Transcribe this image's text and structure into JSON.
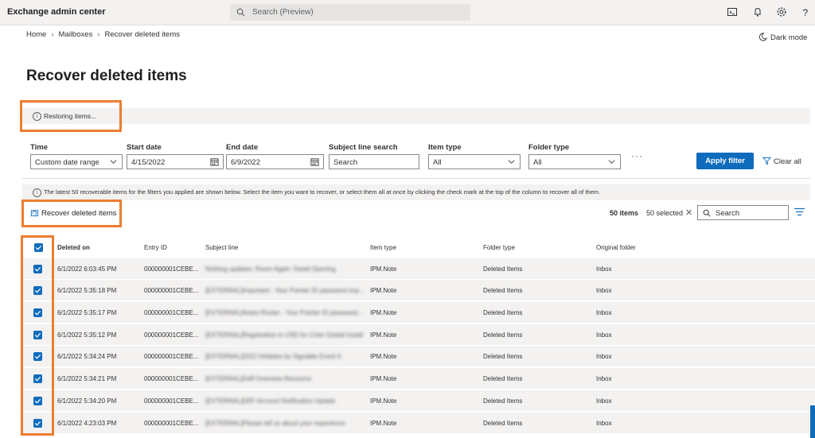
{
  "app": {
    "title": "Exchange admin center"
  },
  "search": {
    "placeholder": "Search (Preview)"
  },
  "topbar_icons": [
    "terminal-icon",
    "bell-icon",
    "gear-icon",
    "help-icon"
  ],
  "breadcrumb": [
    "Home",
    "Mailboxes",
    "Recover deleted items"
  ],
  "dark_mode": "Dark mode",
  "page_title": "Recover deleted items",
  "status": {
    "restoring": "Restoring items..."
  },
  "filters": {
    "time": {
      "label": "Time",
      "value": "Custom date range"
    },
    "start_date": {
      "label": "Start date",
      "value": "4/15/2022"
    },
    "end_date": {
      "label": "End date",
      "value": "6/9/2022"
    },
    "subject": {
      "label": "Subject line search",
      "placeholder": "Search"
    },
    "item_type": {
      "label": "Item type",
      "value": "All"
    },
    "folder_type": {
      "label": "Folder type",
      "value": "All"
    },
    "more": "···",
    "apply": "Apply filter",
    "clear": "Clear all"
  },
  "notice": "The latest 50 recoverable items for the filters you applied are shown below. Select the item you want to recover, or select them all at once by clicking the check mark at the top of the column to recover all of them.",
  "toolbar": {
    "recover": "Recover deleted items",
    "items_count": "50 items",
    "selected_count": "50 selected",
    "search_placeholder": "Search"
  },
  "table": {
    "columns": [
      "Deleted on",
      "Entry ID",
      "Subject line",
      "Item type",
      "Folder type",
      "Original folder"
    ],
    "rows": [
      {
        "deleted_on": "6/1/2022 6:03:45 PM",
        "entry_id": "000000001CEBE...",
        "subject": "Nothing updates: Room Again: Detail Opening",
        "item_type": "IPM.Note",
        "folder_type": "Deleted Items",
        "original_folder": "Inbox"
      },
      {
        "deleted_on": "6/1/2022 5:35:18 PM",
        "entry_id": "000000001CEBE...",
        "subject": "[EXTERNAL]Important - Your Pointer ID password exp...",
        "item_type": "IPM.Note",
        "folder_type": "Deleted Items",
        "original_folder": "Inbox"
      },
      {
        "deleted_on": "6/1/2022 5:35:17 PM",
        "entry_id": "000000001CEBE...",
        "subject": "[EXTERNAL]Notes Router - Your Pointer ID password...",
        "item_type": "IPM.Note",
        "folder_type": "Deleted Items",
        "original_folder": "Inbox"
      },
      {
        "deleted_on": "6/1/2022 5:35:12 PM",
        "entry_id": "000000001CEBE...",
        "subject": "[EXTERNAL]Registration in USD for Color Global Install",
        "item_type": "IPM.Note",
        "folder_type": "Deleted Items",
        "original_folder": "Inbox"
      },
      {
        "deleted_on": "6/1/2022 5:34:24 PM",
        "entry_id": "000000001CEBE...",
        "subject": "[EXTERNAL]2022 Infobites by Signable Event II",
        "item_type": "IPM.Note",
        "folder_type": "Deleted Items",
        "original_folder": "Inbox"
      },
      {
        "deleted_on": "6/1/2022 5:34:21 PM",
        "entry_id": "000000001CEBE...",
        "subject": "[EXTERNAL]Daff Overview Resource",
        "item_type": "IPM.Note",
        "folder_type": "Deleted Items",
        "original_folder": "Inbox"
      },
      {
        "deleted_on": "6/1/2022 5:34:20 PM",
        "entry_id": "000000001CEBE...",
        "subject": "[EXTERNAL]DEF Account Notification Update",
        "item_type": "IPM.Note",
        "folder_type": "Deleted Items",
        "original_folder": "Inbox"
      },
      {
        "deleted_on": "6/1/2022 4:23:03 PM",
        "entry_id": "000000001CEBE...",
        "subject": "[EXTERNAL]Please tell us about your experience",
        "item_type": "IPM.Note",
        "folder_type": "Deleted Items",
        "original_folder": "Inbox"
      }
    ]
  },
  "colors": {
    "accent": "#0f6cbd",
    "highlight": "#ed7d31",
    "bar": "#f3f2f1"
  }
}
